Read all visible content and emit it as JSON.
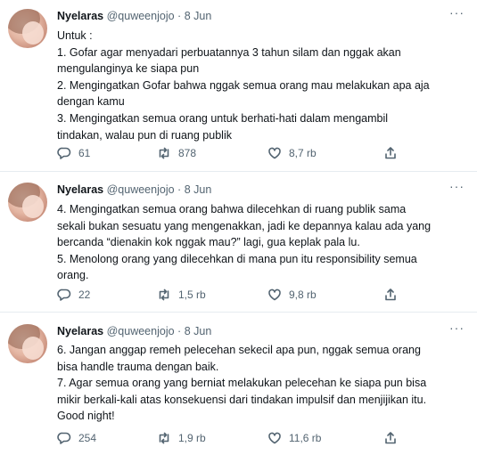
{
  "tweets": [
    {
      "name": "Nyelaras",
      "handle": "@quweenjojo",
      "sep": "·",
      "date": "8 Jun",
      "lines": [
        "Untuk :",
        "1. Gofar agar menyadari perbuatannya 3 tahun silam dan nggak akan",
        "mengulanginya ke siapa pun",
        "2. Mengingatkan Gofar bahwa nggak semua orang mau melakukan apa aja",
        "dengan kamu",
        "3. Mengingatkan semua orang untuk berhati-hati dalam mengambil",
        "tindakan, walau pun di ruang publik"
      ],
      "replies": "61",
      "retweets": "878",
      "likes": "8,7 rb"
    },
    {
      "name": "Nyelaras",
      "handle": "@quweenjojo",
      "sep": "·",
      "date": "8 Jun",
      "lines": [
        "4. Mengingatkan semua orang bahwa dilecehkan di ruang publik sama",
        "sekali bukan sesuatu yang mengenakkan, jadi ke depannya kalau ada yang",
        "bercanda “dienakin kok nggak mau?” lagi, gua keplak pala lu.",
        "5. Menolong orang yang dilecehkan di mana pun itu responsibility semua",
        "orang."
      ],
      "replies": "22",
      "retweets": "1,5 rb",
      "likes": "9,8 rb"
    },
    {
      "name": "Nyelaras",
      "handle": "@quweenjojo",
      "sep": "·",
      "date": "8 Jun",
      "lines": [
        "6. Jangan anggap remeh pelecehan sekecil apa pun, nggak semua orang",
        "bisa handle trauma dengan baik.",
        "7. Agar semua orang yang berniat melakukan pelecehan ke siapa pun bisa",
        "mikir berkali-kali atas konsekuensi dari tindakan impulsif dan menjijikan itu.",
        "Good night!"
      ],
      "replies": "254",
      "retweets": "1,9 rb",
      "likes": "11,6 rb"
    }
  ],
  "icons": {
    "more": "more-horizontal-icon",
    "reply": "reply-icon",
    "retweet": "retweet-icon",
    "like": "heart-icon",
    "share": "share-icon"
  }
}
